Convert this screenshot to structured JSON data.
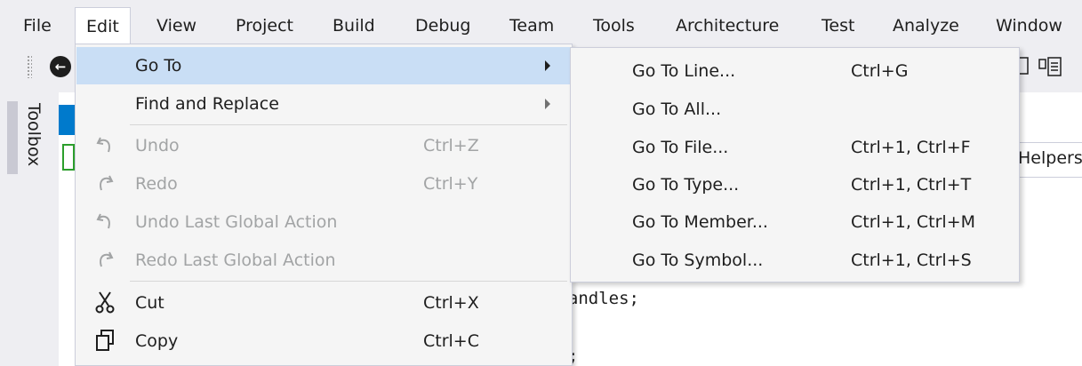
{
  "menubar": {
    "items": [
      {
        "label": "File"
      },
      {
        "label": "Edit"
      },
      {
        "label": "View"
      },
      {
        "label": "Project"
      },
      {
        "label": "Build"
      },
      {
        "label": "Debug"
      },
      {
        "label": "Team"
      },
      {
        "label": "Tools"
      },
      {
        "label": "Architecture"
      },
      {
        "label": "Test"
      },
      {
        "label": "Analyze"
      },
      {
        "label": "Window"
      }
    ]
  },
  "toolbox": {
    "label": "Toolbox"
  },
  "editor": {
    "doc_tab_partial": "Helpers",
    "code_lines": [
      "eHandles;",
      "el;"
    ]
  },
  "edit_menu": {
    "items": [
      {
        "label": "Go To",
        "shortcut": "",
        "icon": "none",
        "enabled": true,
        "submenu": true
      },
      {
        "label": "Find and Replace",
        "shortcut": "",
        "icon": "none",
        "enabled": true,
        "submenu": true
      },
      {
        "label": "Undo",
        "shortcut": "Ctrl+Z",
        "icon": "undo-icon",
        "enabled": false,
        "submenu": false
      },
      {
        "label": "Redo",
        "shortcut": "Ctrl+Y",
        "icon": "redo-icon",
        "enabled": false,
        "submenu": false
      },
      {
        "label": "Undo Last Global Action",
        "shortcut": "",
        "icon": "undo-icon",
        "enabled": false,
        "submenu": false
      },
      {
        "label": "Redo Last Global Action",
        "shortcut": "",
        "icon": "redo-icon",
        "enabled": false,
        "submenu": false
      },
      {
        "label": "Cut",
        "shortcut": "Ctrl+X",
        "icon": "scissors-icon",
        "enabled": true,
        "submenu": false
      },
      {
        "label": "Copy",
        "shortcut": "Ctrl+C",
        "icon": "copy-icon",
        "enabled": true,
        "submenu": false
      }
    ]
  },
  "goto_submenu": {
    "items": [
      {
        "label": "Go To Line...",
        "shortcut": "Ctrl+G"
      },
      {
        "label": "Go To All...",
        "shortcut": ""
      },
      {
        "label": "Go To File...",
        "shortcut": "Ctrl+1, Ctrl+F"
      },
      {
        "label": "Go To Type...",
        "shortcut": "Ctrl+1, Ctrl+T"
      },
      {
        "label": "Go To Member...",
        "shortcut": "Ctrl+1, Ctrl+M"
      },
      {
        "label": "Go To Symbol...",
        "shortcut": "Ctrl+1, Ctrl+S"
      }
    ]
  },
  "colors": {
    "menu_highlight": "#c9def5",
    "accent": "#007acc",
    "disabled_text": "#a2a4a5",
    "chrome_bg": "#eeeef2"
  }
}
